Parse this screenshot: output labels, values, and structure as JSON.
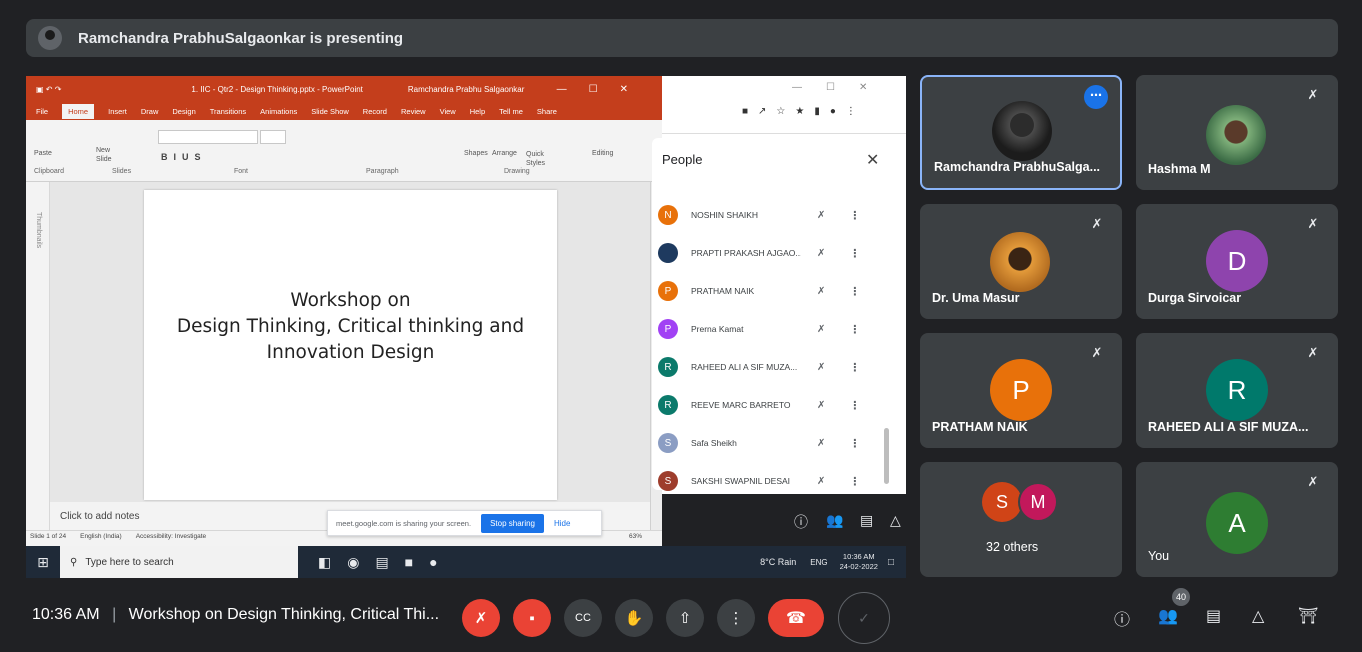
{
  "banner": {
    "text": "Ramchandra PrabhuSalgaonkar is presenting"
  },
  "ppt": {
    "title": "1. IIC - Qtr2 - Design Thinking.pptx - PowerPoint",
    "user": "Ramchandra Prabhu Salgaonkar",
    "tell_me": "Tell me",
    "share": "Share",
    "menu": [
      "File",
      "Home",
      "Insert",
      "Draw",
      "Design",
      "Transitions",
      "Animations",
      "Slide Show",
      "Record",
      "Review",
      "View",
      "Help"
    ],
    "groups": {
      "clipboard": "Clipboard",
      "slides": "Slides",
      "font": "Font",
      "paragraph": "Paragraph",
      "drawing": "Drawing"
    },
    "ribbon": {
      "paste": "Paste",
      "new_slide": "New Slide",
      "shapes": "Shapes",
      "arrange": "Arrange",
      "quick": "Quick Styles",
      "editing": "Editing",
      "thumbnails": "Thumbnails"
    },
    "slide": {
      "line1": "Workshop on",
      "line2": "Design Thinking, Critical thinking and",
      "line3": "Innovation Design"
    },
    "notes": "Click to add notes",
    "status": {
      "slide": "Slide 1 of 24",
      "lang": "English (India)",
      "access": "Accessibility: Investigate",
      "zoom": "63%"
    }
  },
  "sharebar": {
    "text": "meet.google.com is sharing your screen.",
    "stop": "Stop sharing",
    "hide": "Hide"
  },
  "people": {
    "header": "People",
    "rows": [
      {
        "initial": "N",
        "name": "NOSHIN SHAIKH",
        "color": "#e8710a"
      },
      {
        "initial": "",
        "name": "PRAPTI PRAKASH AJGAO...",
        "color": "#1e3a5f"
      },
      {
        "initial": "P",
        "name": "PRATHAM NAIK",
        "color": "#e8710a"
      },
      {
        "initial": "P",
        "name": "Prerna Kamat",
        "color": "#a142f4"
      },
      {
        "initial": "R",
        "name": "RAHEED ALI A SIF MUZA...",
        "color": "#0b7a6b"
      },
      {
        "initial": "R",
        "name": "REEVE MARC BARRETO",
        "color": "#0b7a6b"
      },
      {
        "initial": "S",
        "name": "Safa Sheikh",
        "color": "#8b9dc3"
      },
      {
        "initial": "S",
        "name": "SAKSHI SWAPNIL DESAI",
        "color": "#9e3d2c"
      }
    ],
    "count": "40"
  },
  "taskbar": {
    "search": "Type here to search",
    "weather": "8°C Rain",
    "lang": "ENG",
    "time": "10:36 AM",
    "date": "24-02-2022"
  },
  "tiles": [
    {
      "name": "Ramchandra PrabhuSalga..."
    },
    {
      "name": "Hashma M"
    },
    {
      "name": "Dr. Uma Masur"
    },
    {
      "name": "Durga Sirvoicar",
      "initial": "D",
      "color": "#8e44ad"
    },
    {
      "name": "PRATHAM NAIK",
      "initial": "P",
      "color": "#e8710a"
    },
    {
      "name": "RAHEED ALI A SIF MUZA...",
      "initial": "R",
      "color": "#00796b"
    },
    {
      "name": "32 others",
      "s": "S",
      "m": "M",
      "scolor": "#d04417",
      "mcolor": "#c2185b"
    },
    {
      "name": "You",
      "initial": "A",
      "color": "#2e7d32"
    }
  ],
  "bottom": {
    "time": "10:36 AM",
    "separator": "|",
    "meeting": "Workshop on Design Thinking, Critical Thi...",
    "participants": "40"
  },
  "icons": {
    "mic_off": "mic-off-icon",
    "cam_off": "camera-off-icon",
    "cc": "captions-icon",
    "hand": "raise-hand-icon",
    "present": "present-icon",
    "more": "more-vert-icon",
    "end": "end-call-icon",
    "info": "info-icon",
    "people": "people-icon",
    "chat": "chat-icon",
    "activities": "activities-icon",
    "host": "host-controls-icon"
  }
}
